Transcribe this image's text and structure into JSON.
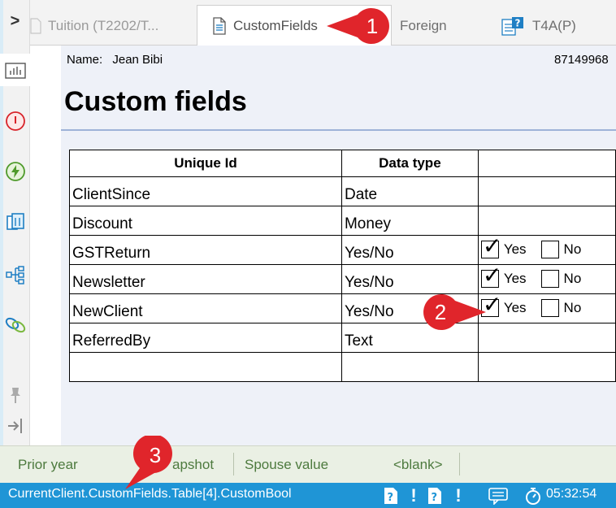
{
  "tabs": [
    {
      "label": "Tuition (T2202/T..."
    },
    {
      "label": "CustomFields",
      "active": true
    },
    {
      "label": "Foreign"
    },
    {
      "label": "T4A(P)"
    }
  ],
  "rail": {
    "expand_glyph": ">",
    "icons": [
      "chart-icon",
      "warning-icon",
      "lightning-icon",
      "copy-icon",
      "tree-icon",
      "link-icon",
      "pin-icon",
      "dock-icon"
    ]
  },
  "form": {
    "name_label": "Name:",
    "name_value": "Jean Bibi",
    "sin": "87149968",
    "title": "Custom fields",
    "columns": {
      "id": "Unique Id",
      "type": "Data type",
      "value": ""
    },
    "rows": [
      {
        "id": "ClientSince",
        "type": "Date",
        "yesno": false
      },
      {
        "id": "Discount",
        "type": "Money",
        "yesno": false
      },
      {
        "id": "GSTReturn",
        "type": "Yes/No",
        "yesno": true,
        "checked": true
      },
      {
        "id": "Newsletter",
        "type": "Yes/No",
        "yesno": true,
        "checked": true
      },
      {
        "id": "NewClient",
        "type": "Yes/No",
        "yesno": true,
        "checked": true
      },
      {
        "id": "ReferredBy",
        "type": "Text",
        "yesno": false
      },
      {
        "id": "",
        "type": "",
        "yesno": false
      }
    ],
    "yes_label": "Yes",
    "no_label": "No"
  },
  "valuebar": {
    "prior_year": "Prior year",
    "snapshot": "apshot",
    "spouse_value": "Spouse value",
    "blank": "<blank>"
  },
  "status": {
    "path": "CurrentClient.CustomFields.Table[4].CustomBool",
    "time": "05:32:54"
  },
  "callouts": [
    "1",
    "2",
    "3"
  ],
  "colors": {
    "status_bg": "#1f95d6",
    "valuebar_bg": "#eaf0e4",
    "valuebar_text": "#4d7a3e",
    "form_bg": "#eef1f8",
    "callout_red": "#e0252b"
  }
}
